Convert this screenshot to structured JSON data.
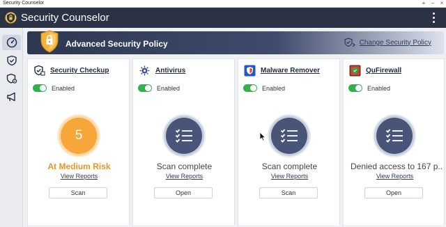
{
  "os": {
    "title": "Security Counselor",
    "controls": [
      "+",
      "−",
      "×"
    ]
  },
  "app": {
    "title": "Security Counselor",
    "menu_icon": "more-vertical-icon"
  },
  "sidebar": {
    "items": [
      {
        "icon": "dashboard-gauge-icon",
        "active": true
      },
      {
        "icon": "shield-check-icon",
        "active": false
      },
      {
        "icon": "shield-gear-icon",
        "active": false
      },
      {
        "icon": "megaphone-icon",
        "active": false
      }
    ]
  },
  "banner": {
    "title": "Advanced Security Policy",
    "link": "Change Security Policy",
    "icon": "shield-lock-icon"
  },
  "colors": {
    "header": "#2b3245",
    "toggle_on": "#2fb24a",
    "warning": "#f7a63a",
    "ok_circle": "#495578"
  },
  "cards": [
    {
      "name": "Security Checkup",
      "toggle": "Enabled",
      "score": "5",
      "status": "At Medium Risk",
      "reports": "View Reports",
      "button": "Scan",
      "icon": "shield-checkup-icon"
    },
    {
      "name": "Antivirus",
      "toggle": "Enabled",
      "status": "Scan complete",
      "reports": "View Reports",
      "button": "Open",
      "icon": "antivirus-icon"
    },
    {
      "name": "Malware Remover",
      "toggle": "Enabled",
      "status": "Scan complete",
      "reports": "View Reports",
      "button": "Scan",
      "icon": "malware-remover-icon"
    },
    {
      "name": "QuFirewall",
      "toggle": "Enabled",
      "status": "Denied access to 167 p...",
      "reports": "View Reports",
      "button": "Open",
      "icon": "firewall-icon"
    }
  ]
}
